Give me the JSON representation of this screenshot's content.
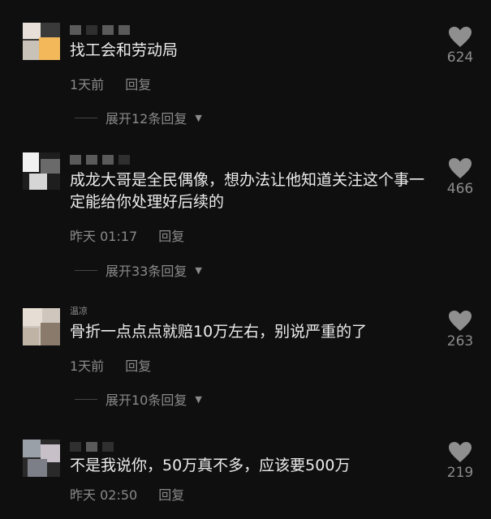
{
  "comments": [
    {
      "username": "",
      "text": "找工会和劳动局",
      "time": "1天前",
      "reply_label": "回复",
      "expand_label": "展开12条回复",
      "likes": "624"
    },
    {
      "username": "",
      "text": "成龙大哥是全民偶像，想办法让他知道关注这个事一定能给你处理好后续的",
      "time": "昨天 01:17",
      "reply_label": "回复",
      "expand_label": "展开33条回复",
      "likes": "466"
    },
    {
      "username": "温凉",
      "text": "骨折一点点点就赔10万左右，别说严重的了",
      "time": "1天前",
      "reply_label": "回复",
      "expand_label": "展开10条回复",
      "likes": "263"
    },
    {
      "username": "",
      "text": "不是我说你，50万真不多，应该要500万",
      "time": "昨天 02:50",
      "reply_label": "回复",
      "likes": "219"
    }
  ],
  "icons": {
    "like": "heart-icon",
    "expand": "triangle-down-icon"
  },
  "colors": {
    "background": "#0f0f0f",
    "text": "#ececec",
    "muted": "#8a8a8a"
  }
}
